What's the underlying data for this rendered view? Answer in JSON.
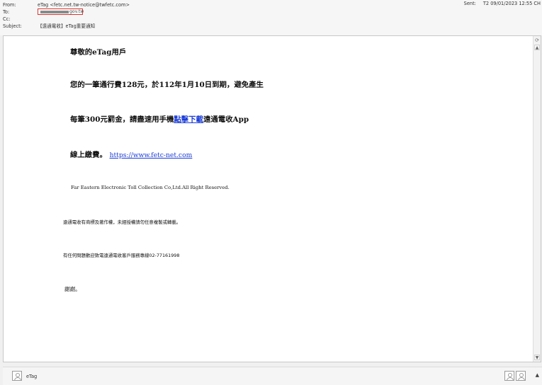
{
  "header": {
    "from_label": "From:",
    "from_value": "eTag <fetc.net.tw-notice@twfetc.com>",
    "to_label": "To:",
    "to_value_visible": "gov.tw",
    "cc_label": "Cc:",
    "subject_label": "Subject:",
    "subject_value": "【遠通電收】eTag重要通知",
    "sent_label": "Sent:",
    "sent_value": "T2 09/01/2023 12:55 CH"
  },
  "body": {
    "greeting": "尊敬的eTag用戶",
    "line1": "您的一筆通行費128元，於112年1月10日到期，避免產生",
    "line2_pre": "每筆300元罰金，請盡速用手機",
    "line2_link": "點擊下載",
    "line2_post": "遠通電收App",
    "line3_pre": "線上繳費。",
    "line3_link": "https://www.fetc-net.com",
    "company": "Far Eastern Electronic Toll Collection Co,Ltd.All Right Reserved.",
    "copyright": "遠通電收有商標及著作權，未經授權請勿任意複製或轉載。",
    "hotline": "有任何問題歡迎致電遠通電收客戶服務專線02-77161998",
    "thanks": "謝謝。"
  },
  "people": {
    "name": "eTag"
  }
}
